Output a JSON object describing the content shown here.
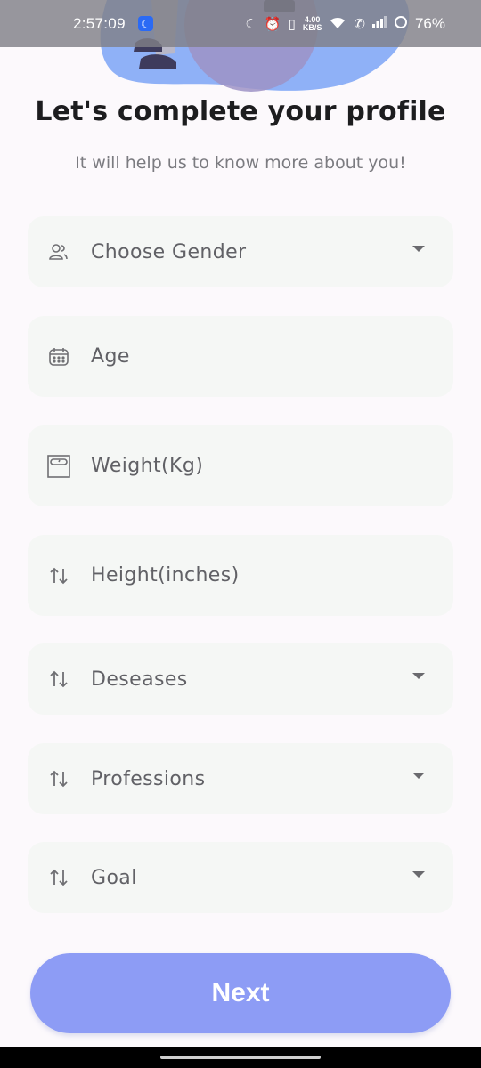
{
  "status_bar": {
    "time": "2:57:09",
    "net_speed_value": "4.00",
    "net_speed_unit": "KB/S",
    "battery": "76%"
  },
  "header": {
    "title": "Let's complete your profile",
    "subtitle": "It will help us to know more about you!"
  },
  "form": {
    "gender": {
      "label": "Choose Gender",
      "icon": "users-icon"
    },
    "age": {
      "label": "Age",
      "icon": "calendar-icon"
    },
    "weight": {
      "label": "Weight(Kg)",
      "icon": "scale-icon"
    },
    "height": {
      "label": "Height(inches)",
      "icon": "swap-vertical-icon"
    },
    "diseases": {
      "label": "Deseases",
      "icon": "swap-vertical-icon"
    },
    "professions": {
      "label": "Professions",
      "icon": "swap-vertical-icon"
    },
    "goal": {
      "label": "Goal",
      "icon": "swap-vertical-icon"
    }
  },
  "next_button": {
    "label": "Next"
  },
  "colors": {
    "accent": "#8d9cf5",
    "field_bg": "#f5f7f5",
    "title": "#1d1d1f",
    "hero_blue": "#8fb1f7"
  }
}
